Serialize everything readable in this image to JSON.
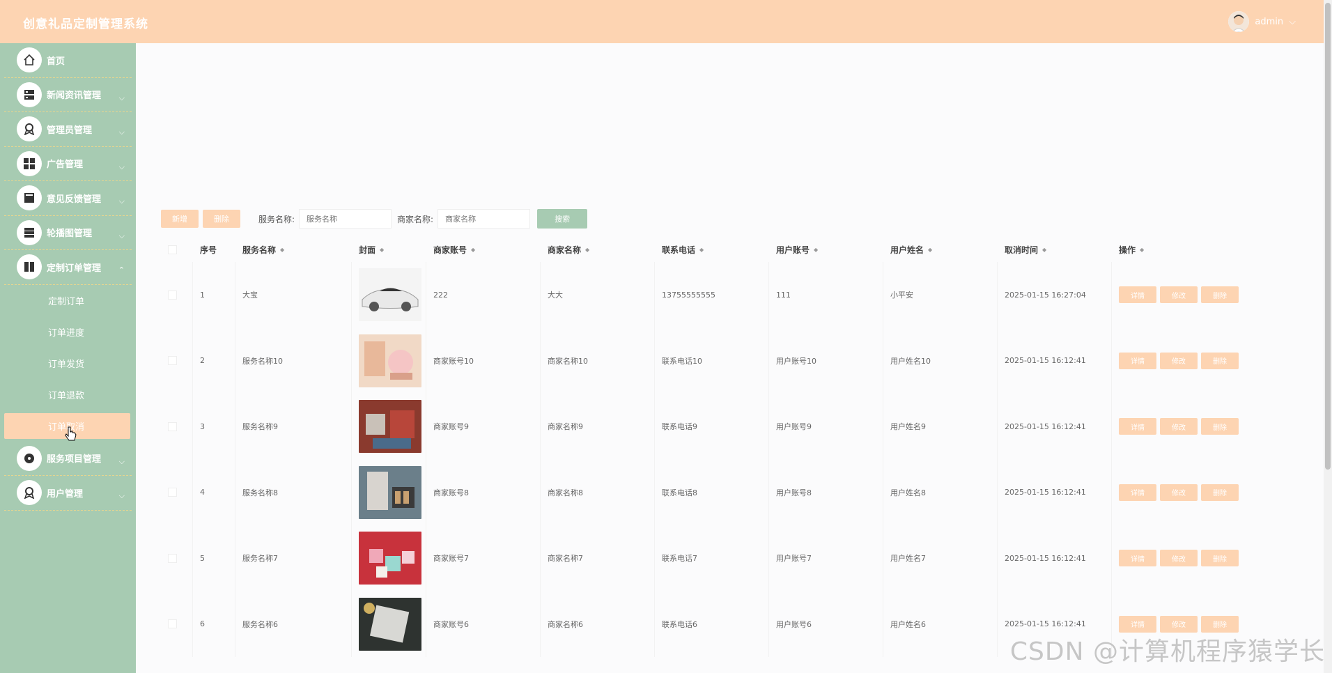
{
  "header": {
    "title": "创意礼品定制管理系统",
    "username": "admin",
    "dropdown_icon": "chevron-down-icon"
  },
  "sidebar": {
    "items": [
      {
        "label": "首页",
        "icon": "home-icon",
        "has_arrow": false
      },
      {
        "label": "新闻资讯管理",
        "icon": "news-icon",
        "has_arrow": true
      },
      {
        "label": "管理员管理",
        "icon": "admin-icon",
        "has_arrow": true
      },
      {
        "label": "广告管理",
        "icon": "grid-icon",
        "has_arrow": true
      },
      {
        "label": "意见反馈管理",
        "icon": "feedback-icon",
        "has_arrow": true
      },
      {
        "label": "轮播图管理",
        "icon": "carousel-icon",
        "has_arrow": true
      },
      {
        "label": "定制订单管理",
        "icon": "order-icon",
        "has_arrow": true,
        "expanded": true
      }
    ],
    "sub_items": [
      "定制订单",
      "订单进度",
      "订单发货",
      "订单退款",
      "订单取消"
    ],
    "active_sub": "订单取消",
    "items_after": [
      {
        "label": "服务项目管理",
        "icon": "service-icon",
        "has_arrow": true
      },
      {
        "label": "用户管理",
        "icon": "user-icon",
        "has_arrow": true
      }
    ]
  },
  "toolbar": {
    "add_label": "新增",
    "delete_label": "删除",
    "service_name_label": "服务名称:",
    "service_name_placeholder": "服务名称",
    "merchant_name_label": "商家名称:",
    "merchant_name_placeholder": "商家名称",
    "search_label": "搜索"
  },
  "table": {
    "columns": [
      "序号",
      "服务名称",
      "封面",
      "商家账号",
      "商家名称",
      "联系电话",
      "用户账号",
      "用户姓名",
      "取消时间",
      "操作"
    ],
    "rows": [
      {
        "index": "1",
        "service": "大宝",
        "merchant_account": "222",
        "merchant_name": "大大",
        "phone": "13755555555",
        "user_account": "111",
        "user_name": "小平安",
        "cancel_time": "2025-01-15 16:27:04"
      },
      {
        "index": "2",
        "service": "服务名称10",
        "merchant_account": "商家账号10",
        "merchant_name": "商家名称10",
        "phone": "联系电话10",
        "user_account": "用户账号10",
        "user_name": "用户姓名10",
        "cancel_time": "2025-01-15 16:12:41"
      },
      {
        "index": "3",
        "service": "服务名称9",
        "merchant_account": "商家账号9",
        "merchant_name": "商家名称9",
        "phone": "联系电话9",
        "user_account": "用户账号9",
        "user_name": "用户姓名9",
        "cancel_time": "2025-01-15 16:12:41"
      },
      {
        "index": "4",
        "service": "服务名称8",
        "merchant_account": "商家账号8",
        "merchant_name": "商家名称8",
        "phone": "联系电话8",
        "user_account": "用户账号8",
        "user_name": "用户姓名8",
        "cancel_time": "2025-01-15 16:12:41"
      },
      {
        "index": "5",
        "service": "服务名称7",
        "merchant_account": "商家账号7",
        "merchant_name": "商家名称7",
        "phone": "联系电话7",
        "user_account": "用户账号7",
        "user_name": "用户姓名7",
        "cancel_time": "2025-01-15 16:12:41"
      },
      {
        "index": "6",
        "service": "服务名称6",
        "merchant_account": "商家账号6",
        "merchant_name": "商家名称6",
        "phone": "联系电话6",
        "user_account": "用户账号6",
        "user_name": "用户姓名6",
        "cancel_time": "2025-01-15 16:12:41"
      }
    ],
    "actions": {
      "detail": "详情",
      "edit": "修改",
      "delete": "删除"
    }
  },
  "watermark": "CSDN @计算机程序猿学长",
  "colors": {
    "header": "#fdd4b2",
    "sidebar": "#a7cbb2",
    "button": "#fdd4b2",
    "search_button": "#a7cbb2"
  }
}
